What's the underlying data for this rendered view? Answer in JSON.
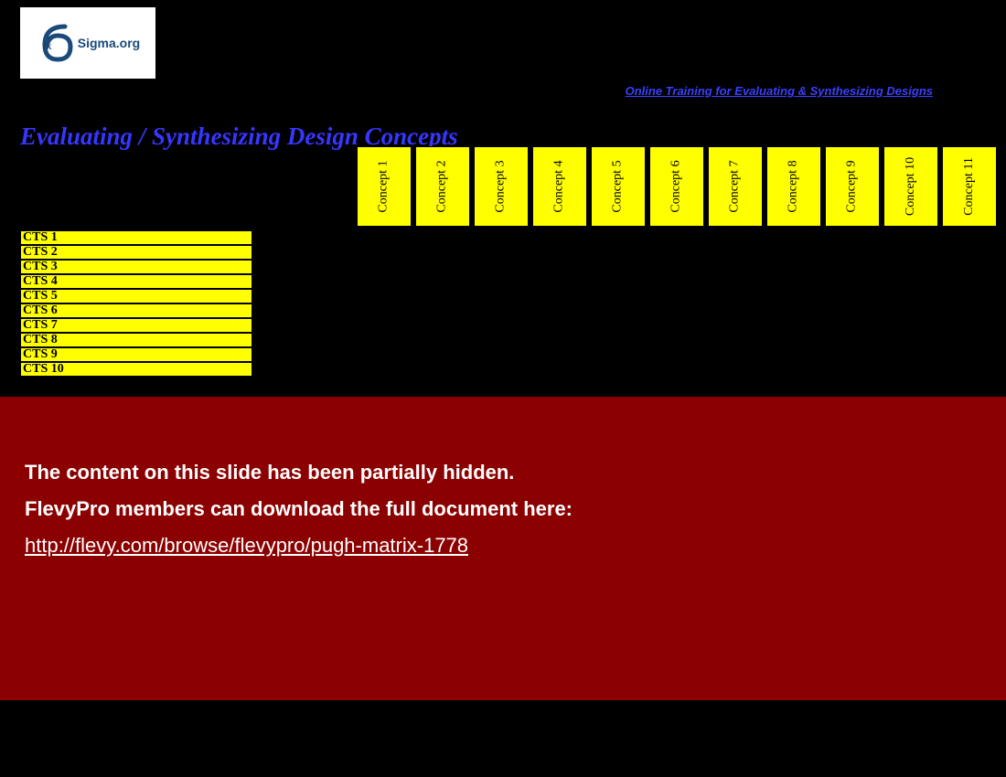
{
  "logo": {
    "ix": "Ix",
    "text": "Sigma.org"
  },
  "training_link": "Online Training for Evaluating & Synthesizing Designs",
  "title": "Evaluating / Synthesizing Design Concepts",
  "concepts": [
    "Concept 1",
    "Concept 2",
    "Concept 3",
    "Concept 4",
    "Concept 5",
    "Concept 6",
    "Concept 7",
    "Concept 8",
    "Concept 9",
    "Concept 10",
    "Concept 11"
  ],
  "cts": [
    "CTS 1",
    "CTS 2",
    "CTS 3",
    "CTS 4",
    "CTS 5",
    "CTS 6",
    "CTS 7",
    "CTS 8",
    "CTS 9",
    "CTS 10"
  ],
  "overlay": {
    "line1": "The content on this slide has been partially hidden.",
    "line2": "FlevyPro members can download the full document here:",
    "link": "http://flevy.com/browse/flevypro/pugh-matrix-1778"
  }
}
